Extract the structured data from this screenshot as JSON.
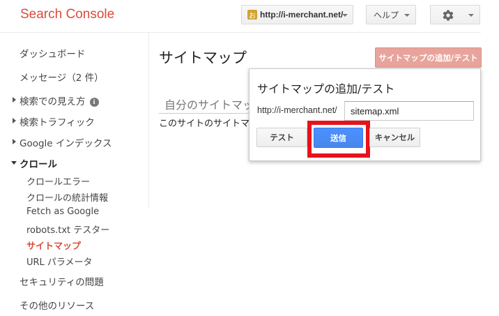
{
  "header": {
    "logo": "Search Console",
    "site_favicon_char": "お",
    "site_url": "http://i-merchant.net/",
    "help_label": "ヘルプ",
    "settings_icon": "gear-icon"
  },
  "sidebar": {
    "dashboard": "ダッシュボード",
    "messages": "メッセージ（2 件）",
    "search_appearance": "検索での見え方",
    "search_appearance_info": "i",
    "search_traffic": "検索トラフィック",
    "google_index": "Google インデックス",
    "crawl": "クロール",
    "crawl_errors": "クロールエラー",
    "crawl_stats": "クロールの統計情報",
    "fetch_as_google": "Fetch as Google",
    "robots_tester": "robots.txt テスター",
    "sitemaps": "サイトマップ",
    "url_parameters": "URL パラメータ",
    "security_issues": "セキュリティの問題",
    "other_resources": "その他のリソース"
  },
  "main": {
    "title": "サイトマップ",
    "add_test_button": "サイトマップの追加/テスト",
    "tab_mine": "自分のサイトマップ",
    "site_sitemaps_text": "このサイトのサイトマップ"
  },
  "dialog": {
    "title": "サイトマップの追加/テスト",
    "url_prefix": "http://i-merchant.net/",
    "input_value": "sitemap.xml",
    "test_button": "テスト",
    "submit_button": "送信",
    "cancel_button": "キャンセル"
  },
  "colors": {
    "brand_red": "#dd4b39",
    "submit_blue": "#4d90fe",
    "highlight_red": "#e8121b",
    "add_button_pink": "#e8a49c"
  }
}
